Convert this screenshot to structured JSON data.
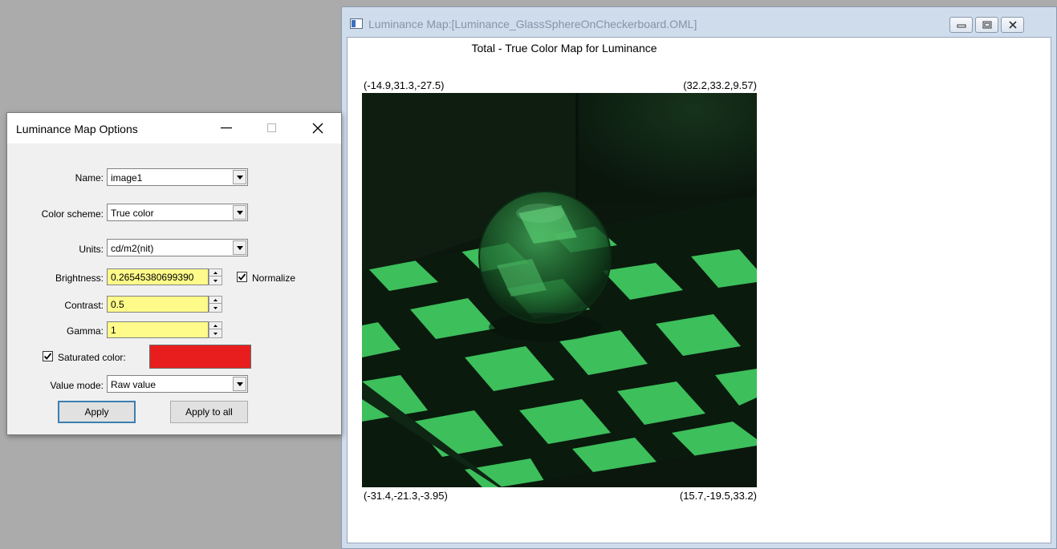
{
  "map_window": {
    "title": "Luminance Map:[Luminance_GlassSphereOnCheckerboard.OML]",
    "heading": "Total - True Color Map for Luminance",
    "coords": {
      "top_left": "(-14.9,31.3,-27.5)",
      "top_right": "(32.2,33.2,9.57)",
      "bottom_left": "(-31.4,-21.3,-3.95)",
      "bottom_right": "(15.7,-19.5,33.2)"
    },
    "controls": {
      "minimize_icon": "minimize-icon",
      "restore_icon": "restore-icon",
      "close_icon": "close-icon"
    }
  },
  "options_dialog": {
    "title": "Luminance Map Options",
    "name_label": "Name:",
    "name_value": "image1",
    "color_scheme_label": "Color scheme:",
    "color_scheme_value": "True color",
    "units_label": "Units:",
    "units_value": "cd/m2(nit)",
    "brightness_label": "Brightness:",
    "brightness_value": "0.26545380699390",
    "normalize_label": "Normalize",
    "normalize_checked": true,
    "contrast_label": "Contrast:",
    "contrast_value": "0.5",
    "gamma_label": "Gamma:",
    "gamma_value": "1",
    "saturated_label": "Saturated color:",
    "saturated_checked": true,
    "saturated_color": "#e81e1e",
    "value_mode_label": "Value mode:",
    "value_mode_value": "Raw value",
    "apply_label": "Apply",
    "apply_all_label": "Apply to all"
  },
  "colors": {
    "field_highlight": "#fffb8a",
    "checker_green": "#3dbf5c",
    "desktop_gray": "#ababab"
  }
}
